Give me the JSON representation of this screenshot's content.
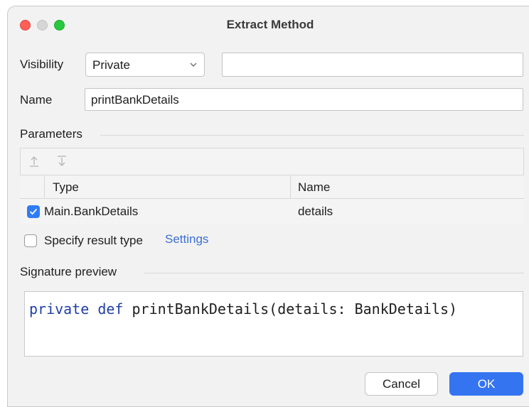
{
  "window": {
    "title": "Extract Method"
  },
  "form": {
    "visibility_label": "Visibility",
    "visibility_value": "Private",
    "extra_field_value": "",
    "name_label": "Name",
    "name_value": "printBankDetails"
  },
  "parameters": {
    "section_title": "Parameters",
    "move_up_icon": "arrow-up-icon",
    "move_down_icon": "arrow-down-icon",
    "columns": [
      "Type",
      "Name"
    ],
    "rows": [
      {
        "checked": true,
        "type": "Main.BankDetails",
        "name": "details"
      }
    ]
  },
  "options": {
    "specify_result_type_label": "Specify result type",
    "specify_result_type_checked": false,
    "settings_link": "Settings"
  },
  "signature": {
    "section_title": "Signature preview",
    "keyword_1": "private",
    "keyword_2": "def",
    "rest": "printBankDetails(details: BankDetails)"
  },
  "buttons": {
    "cancel": "Cancel",
    "ok": "OK"
  },
  "colors": {
    "accent": "#3574f0",
    "link": "#3b6fd4",
    "keyword": "#1f3fa6",
    "checkbox_checked": "#2f7cf6"
  }
}
